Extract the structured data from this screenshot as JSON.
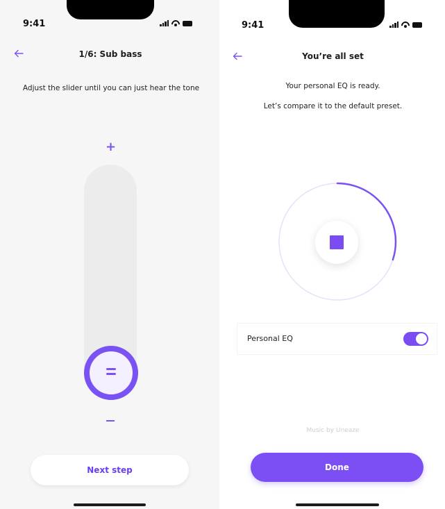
{
  "colors": {
    "accent": "#7a52f4",
    "accent_deep": "#6a3ff0",
    "track": "#ececec"
  },
  "left_screen": {
    "status": {
      "time": "9:41"
    },
    "header": {
      "title": "1/6: Sub bass",
      "back_icon": "arrow-left-icon"
    },
    "instruction": "Adjust the slider until you can just hear the tone",
    "slider": {
      "increase_label": "+",
      "decrease_label": "–",
      "level": 0.1
    },
    "next_button": "Next step"
  },
  "right_screen": {
    "status": {
      "time": "9:41"
    },
    "header": {
      "title": "You’re all set",
      "back_icon": "arrow-left-icon"
    },
    "message_line1": "Your personal EQ is ready.",
    "message_line2": "Let’s compare it to the default preset.",
    "playback": {
      "progress": 0.3,
      "control_icon": "stop-icon"
    },
    "personal_eq": {
      "label": "Personal EQ",
      "enabled": true
    },
    "credit": "Music by Uneaze",
    "done_button": "Done"
  }
}
